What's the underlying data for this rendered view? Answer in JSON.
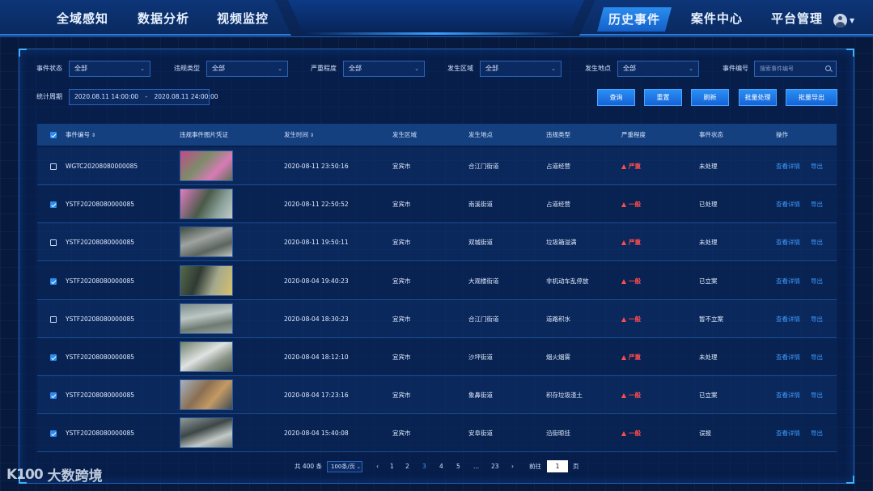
{
  "nav": {
    "left": [
      "全域感知",
      "数据分析",
      "视频监控"
    ],
    "right": [
      "历史事件",
      "案件中心",
      "平台管理"
    ],
    "active": "历史事件"
  },
  "filters": {
    "status_label": "事件状态",
    "status_value": "全部",
    "type_label": "违规类型",
    "type_value": "全部",
    "severity_label": "严重程度",
    "severity_value": "全部",
    "area_label": "发生区域",
    "area_value": "全部",
    "place_label": "发生地点",
    "place_value": "全部",
    "code_label": "事件编号",
    "code_placeholder": "搜索事件编号",
    "period_label": "统计周期",
    "date_start": "2020.08.11 14:00:00",
    "date_sep": "-",
    "date_end": "2020.08.11 24:00:00"
  },
  "buttons": {
    "query": "查询",
    "reset": "重置",
    "refresh": "刷新",
    "batch_process": "批量处理",
    "batch_export": "批量导出"
  },
  "table": {
    "headers": [
      "事件编号",
      "违规事件图片凭证",
      "发生时间",
      "发生区域",
      "发生地点",
      "违规类型",
      "严重程度",
      "事件状态",
      "操作"
    ],
    "rows": [
      {
        "checked": false,
        "id": "WGTC20208080000085",
        "time": "2020-08-11 23:50:16",
        "area": "宜宾市",
        "place": "合江门街道",
        "type": "占道经营",
        "severity": "严重",
        "status": "未处理",
        "view": "查看详情",
        "export": "导出"
      },
      {
        "checked": true,
        "id": "YSTF20208080000085",
        "time": "2020-08-11 22:50:52",
        "area": "宜宾市",
        "place": "南溪街道",
        "type": "占道经营",
        "severity": "一般",
        "status": "已处理",
        "view": "查看详情",
        "export": "导出"
      },
      {
        "checked": false,
        "id": "YSTF20208080000085",
        "time": "2020-08-11 19:50:11",
        "area": "宜宾市",
        "place": "双城街道",
        "type": "垃圾箱溢满",
        "severity": "严重",
        "status": "未处理",
        "view": "查看详情",
        "export": "导出"
      },
      {
        "checked": true,
        "id": "YSTF20208080000085",
        "time": "2020-08-04 19:40:23",
        "area": "宜宾市",
        "place": "大观楼街道",
        "type": "非机动车乱停放",
        "severity": "一般",
        "status": "已立案",
        "view": "查看详情",
        "export": "导出"
      },
      {
        "checked": false,
        "id": "YSTF20208080000085",
        "time": "2020-08-04 18:30:23",
        "area": "宜宾市",
        "place": "合江门街道",
        "type": "道路积水",
        "severity": "一般",
        "status": "暂不立案",
        "view": "查看详情",
        "export": "导出"
      },
      {
        "checked": true,
        "id": "YSTF20208080000085",
        "time": "2020-08-04 18:12:10",
        "area": "宜宾市",
        "place": "沙坪街道",
        "type": "烟火烟雾",
        "severity": "严重",
        "status": "未处理",
        "view": "查看详情",
        "export": "导出"
      },
      {
        "checked": true,
        "id": "YSTF20208080000085",
        "time": "2020-08-04 17:23:16",
        "area": "宜宾市",
        "place": "象鼻街道",
        "type": "积存垃圾渣土",
        "severity": "一般",
        "status": "已立案",
        "view": "查看详情",
        "export": "导出"
      },
      {
        "checked": true,
        "id": "YSTF20208080000085",
        "time": "2020-08-04 15:40:08",
        "area": "宜宾市",
        "place": "安阜街道",
        "type": "沿街晾挂",
        "severity": "一般",
        "status": "误报",
        "view": "查看详情",
        "export": "导出"
      }
    ]
  },
  "pagination": {
    "total_prefix": "共",
    "total": "400",
    "total_suffix": "条",
    "page_size": "100条/页",
    "pages": [
      "1",
      "2",
      "3",
      "4",
      "5",
      "...",
      "23"
    ],
    "current": "3",
    "goto_label": "前往",
    "goto_value": "1",
    "goto_suffix": "页"
  },
  "watermark": {
    "logo": "K100",
    "text": "大数跨境"
  },
  "colors": {
    "accent": "#2d8cf0",
    "severity": "#ff4d4d",
    "link": "#3c9cff",
    "background": "#071a3e"
  }
}
